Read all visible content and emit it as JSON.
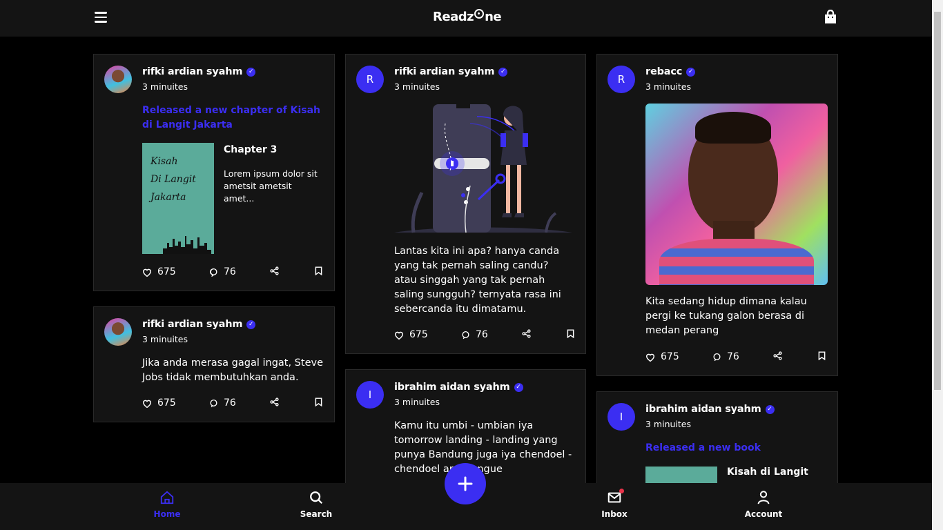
{
  "app": {
    "logo_text_a": "Readz",
    "logo_text_b": "ne"
  },
  "colors": {
    "accent": "#3b2ef2",
    "background": "#000000",
    "card": "#141414",
    "notify": "#e8334a"
  },
  "posts": [
    {
      "author": "rifki ardian syahm",
      "time": "3 minuites",
      "headline": "Released a new chapter of Kisah di Langit Jakarta",
      "book": {
        "cover_line1": "Kisah",
        "cover_line2": "Di Langit",
        "cover_line3": "Jakarta",
        "chapter": "Chapter 3",
        "excerpt": "Lorem ipsum dolor sit ametsit ametsit amet..."
      },
      "likes": "675",
      "comments": "76"
    },
    {
      "author": "rifki ardian syahm",
      "time": "3 minuites",
      "text": "Jika anda merasa gagal ingat, Steve Jobs tidak membutuhkan anda.",
      "likes": "675",
      "comments": "76"
    },
    {
      "avatar_letter": "R",
      "author": "rifki ardian syahm",
      "time": "3 minuites",
      "text": "Lantas kita ini apa? hanya canda yang tak pernah saling candu? atau singgah yang tak pernah saling sungguh? ternyata rasa ini sebercanda itu dimatamu.",
      "likes": "675",
      "comments": "76"
    },
    {
      "avatar_letter": "I",
      "author": "ibrahim aidan syahm",
      "time": "3 minuites",
      "text": "Kamu itu umbi - umbian iya tomorrow landing - landing yang punya Bandung juga iya chendoel - chendoel arsepengue"
    },
    {
      "avatar_letter": "R",
      "author": "rebacc",
      "time": "3 minuites",
      "text": "Kita sedang hidup dimana kalau pergi ke tukang galon berasa di medan perang",
      "likes": "675",
      "comments": "76"
    },
    {
      "avatar_letter": "I",
      "author": "ibrahim aidan syahm",
      "time": "3 minuites",
      "headline": "Released a new book",
      "book_title": "Kisah di Langit"
    }
  ],
  "nav": {
    "home": "Home",
    "search": "Search",
    "inbox": "Inbox",
    "account": "Account"
  }
}
